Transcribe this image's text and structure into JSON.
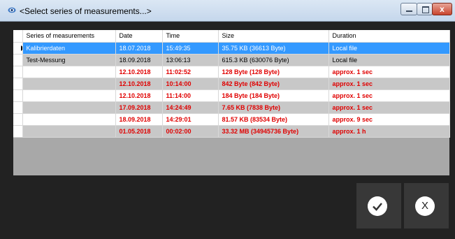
{
  "window": {
    "title": "<Select series of measurements...>",
    "close_label": "x"
  },
  "grid": {
    "columns": [
      "Series of measurements",
      "Date",
      "Time",
      "Size",
      "Duration"
    ],
    "rows": [
      {
        "cells": [
          "Kalibrierdaten",
          "18.07.2018",
          "15:49:35",
          "35.75 KB (36613 Byte)",
          "Local file"
        ],
        "style": "selected"
      },
      {
        "cells": [
          "Test-Messung",
          "18.09.2018",
          "13:06:13",
          "615.3 KB (630076 Byte)",
          "Local file"
        ],
        "style": "gray"
      },
      {
        "cells": [
          "",
          "12.10.2018",
          "11:02:52",
          "128 Byte (128 Byte)",
          "approx. 1 sec"
        ],
        "style": "white-red"
      },
      {
        "cells": [
          "",
          "12.10.2018",
          "10:14:00",
          "842 Byte (842 Byte)",
          "approx. 1 sec"
        ],
        "style": "gray-red"
      },
      {
        "cells": [
          "",
          "12.10.2018",
          "11:14:00",
          "184 Byte (184 Byte)",
          "approx. 1 sec"
        ],
        "style": "white-red"
      },
      {
        "cells": [
          "",
          "17.09.2018",
          "14:24:49",
          "7.65 KB (7838 Byte)",
          "approx. 1 sec"
        ],
        "style": "gray-red"
      },
      {
        "cells": [
          "",
          "18.09.2018",
          "14:29:01",
          "81.57 KB (83534 Byte)",
          "approx. 9 sec"
        ],
        "style": "white-red"
      },
      {
        "cells": [
          "",
          "01.05.2018",
          "00:02:00",
          "33.32 MB (34945736 Byte)",
          "approx. 1 h"
        ],
        "style": "gray-red"
      }
    ]
  },
  "buttons": {
    "ok_icon": "checkmark-icon",
    "cancel_icon": "x-icon",
    "cancel_label": "X"
  },
  "colors": {
    "selection": "#3399ff",
    "warning_text": "#e00000",
    "background": "#222222",
    "button": "#383838"
  }
}
